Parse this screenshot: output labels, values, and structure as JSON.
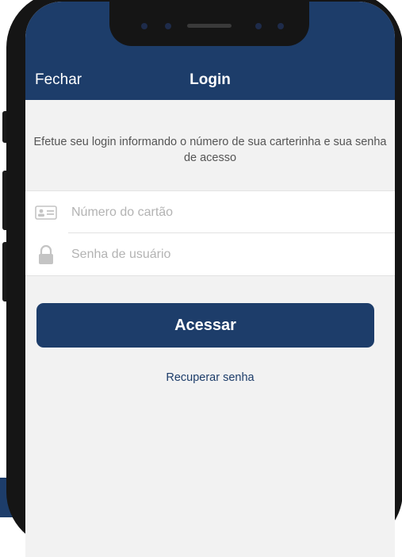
{
  "nav": {
    "close_label": "Fechar",
    "title": "Login"
  },
  "intro": {
    "text": "Efetue seu login informando o número de sua carterinha e sua senha de acesso"
  },
  "form": {
    "card_number": {
      "value": "",
      "placeholder": "Número do cartão",
      "icon": "id-card-icon"
    },
    "password": {
      "value": "",
      "placeholder": "Senha de usuário",
      "icon": "lock-icon"
    }
  },
  "actions": {
    "submit_label": "Acessar",
    "recover_label": "Recuperar senha"
  },
  "colors": {
    "primary": "#1d3d6a",
    "background": "#f2f2f2",
    "placeholder": "#b3b3b3"
  }
}
